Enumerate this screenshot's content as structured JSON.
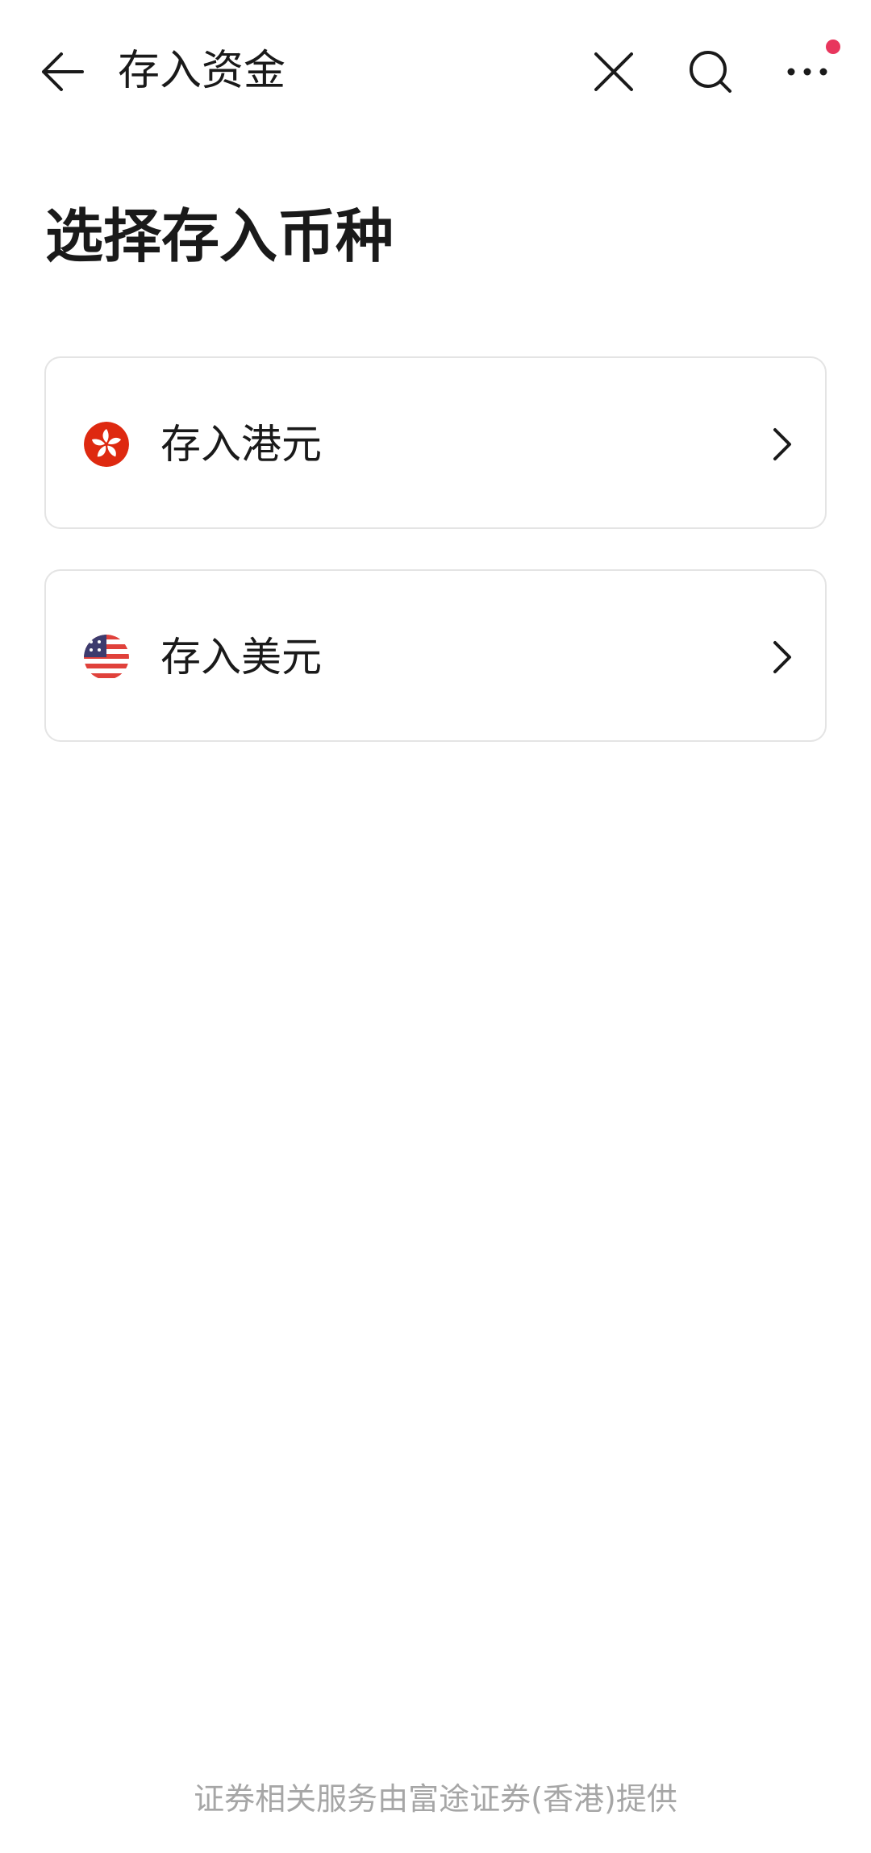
{
  "header": {
    "title": "存入资金",
    "back_icon": "arrow-left-icon",
    "close_icon": "close-icon",
    "search_icon": "search-icon",
    "more_icon": "more-dots-icon",
    "notification_dot_color": "#e8365d"
  },
  "main": {
    "heading": "选择存入币种",
    "options": [
      {
        "label": "存入港元",
        "flag_icon": "hong-kong-flag-icon",
        "arrow_icon": "chevron-right-icon"
      },
      {
        "label": "存入美元",
        "flag_icon": "us-flag-icon",
        "arrow_icon": "chevron-right-icon"
      }
    ]
  },
  "footer": {
    "text": "证券相关服务由富途证券(香港)提供"
  },
  "colors": {
    "text_primary": "#1a1a1a",
    "text_secondary": "#a6a6a6",
    "card_border": "#e4e4e4",
    "hk_red": "#de2910",
    "us_blue": "#3c3b6e",
    "us_red": "#e0413b"
  }
}
